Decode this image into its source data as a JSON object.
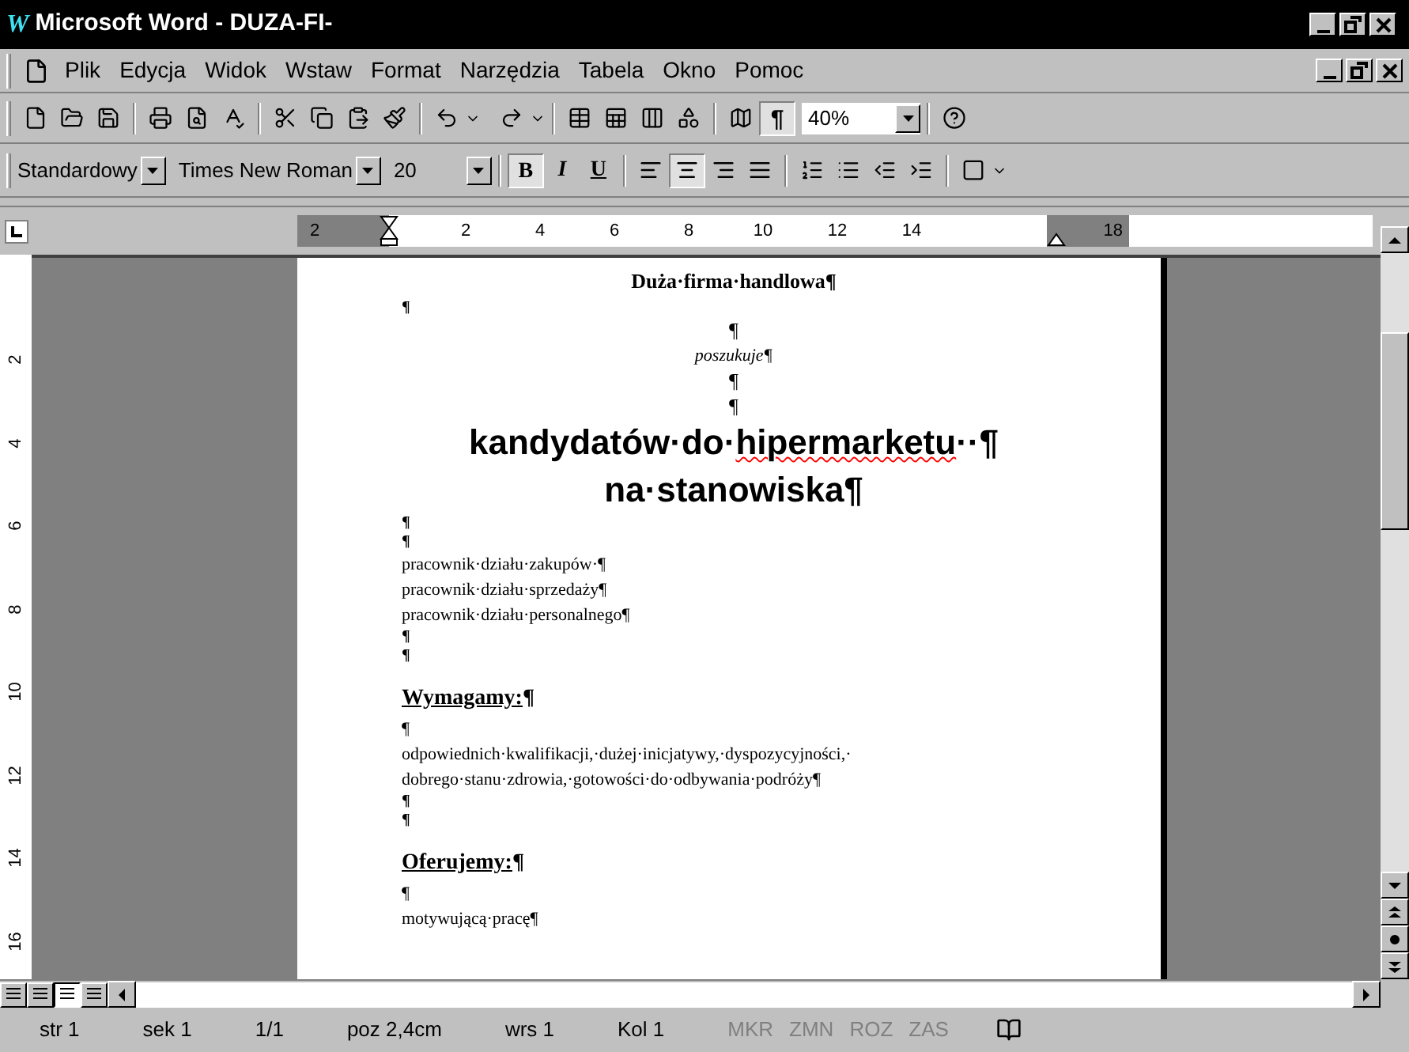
{
  "window": {
    "logo": "W",
    "title": "Microsoft Word - DUZA-FI-"
  },
  "menu": [
    "Plik",
    "Edycja",
    "Widok",
    "Wstaw",
    "Format",
    "Narzędzia",
    "Tabela",
    "Okno",
    "Pomoc"
  ],
  "standard_toolbar": {
    "pilcrow": {
      "label": "¶",
      "selected": true
    },
    "zoom": "40%"
  },
  "formatting_toolbar": {
    "style": "Standardowy",
    "font": "Times New Roman",
    "size": "20",
    "font_styles": [
      {
        "label": "B",
        "kind": "bold",
        "selected": true
      },
      {
        "label": "I",
        "kind": "italic",
        "selected": false
      },
      {
        "label": "U",
        "kind": "underline",
        "selected": false
      }
    ],
    "alignment": [
      {
        "kind": "left",
        "selected": false
      },
      {
        "kind": "center",
        "selected": true
      },
      {
        "kind": "right",
        "selected": false
      },
      {
        "kind": "justify",
        "selected": false
      }
    ]
  },
  "ruler": {
    "labels": [
      "2",
      "2",
      "4",
      "6",
      "8",
      "10",
      "12",
      "14",
      "18"
    ]
  },
  "vertical_ruler": {
    "labels": [
      "2",
      "4",
      "6",
      "8",
      "10",
      "12",
      "14",
      "16"
    ]
  },
  "document": [
    {
      "kind": "heading",
      "text": "Duża·firma·handlowa¶"
    },
    {
      "kind": "tiny",
      "text": "¶"
    },
    {
      "kind": "center",
      "text": "¶"
    },
    {
      "kind": "italic",
      "text": "poszukuje¶"
    },
    {
      "kind": "center",
      "text": "¶"
    },
    {
      "kind": "center",
      "text": "¶"
    },
    {
      "kind": "big",
      "segments": [
        {
          "text": "kandydatów·do·",
          "misspelled": false
        },
        {
          "text": "hipermarketu",
          "misspelled": true
        },
        {
          "text": "··¶",
          "misspelled": false
        }
      ]
    },
    {
      "kind": "big",
      "segments": [
        {
          "text": "na·stanowiska¶",
          "misspelled": false
        }
      ]
    },
    {
      "kind": "tiny",
      "text": "¶"
    },
    {
      "kind": "tiny",
      "text": "¶"
    },
    {
      "kind": "body",
      "text": "pracownik·działu·zakupów·¶"
    },
    {
      "kind": "body",
      "text": "pracownik·działu·sprzedaży¶"
    },
    {
      "kind": "body",
      "text": "pracownik·działu·personalnego¶"
    },
    {
      "kind": "tiny",
      "text": "¶"
    },
    {
      "kind": "tiny",
      "text": "¶"
    },
    {
      "kind": "section",
      "text": "Wymagamy:",
      "mark": "¶"
    },
    {
      "kind": "body",
      "text": "¶"
    },
    {
      "kind": "body",
      "text": "odpowiednich·kwalifikacji,·dużej·inicjatywy,·dyspozycyjności,·"
    },
    {
      "kind": "body",
      "text": "dobrego·stanu·zdrowia,·gotowości·do·odbywania·podróży¶"
    },
    {
      "kind": "tiny",
      "text": "¶"
    },
    {
      "kind": "tiny",
      "text": "¶"
    },
    {
      "kind": "section",
      "text": "Oferujemy:",
      "mark": "¶"
    },
    {
      "kind": "body",
      "text": "¶"
    },
    {
      "kind": "body",
      "text": "motywującą·pracę¶"
    }
  ],
  "view_buttons": [
    {
      "selected": false
    },
    {
      "selected": false
    },
    {
      "selected": true
    },
    {
      "selected": false
    }
  ],
  "status_bar": [
    {
      "text": "str 1",
      "disabled": false
    },
    {
      "text": "sek 1",
      "disabled": false
    },
    {
      "text": "1/1",
      "disabled": false
    },
    {
      "text": "poz 2,4cm",
      "disabled": false
    },
    {
      "text": "wrs 1",
      "disabled": false
    },
    {
      "text": "Kol 1",
      "disabled": false
    },
    {
      "text": "MKR",
      "disabled": true
    },
    {
      "text": "ZMN",
      "disabled": true
    },
    {
      "text": "ROZ",
      "disabled": true
    },
    {
      "text": "ZAS",
      "disabled": true
    }
  ]
}
